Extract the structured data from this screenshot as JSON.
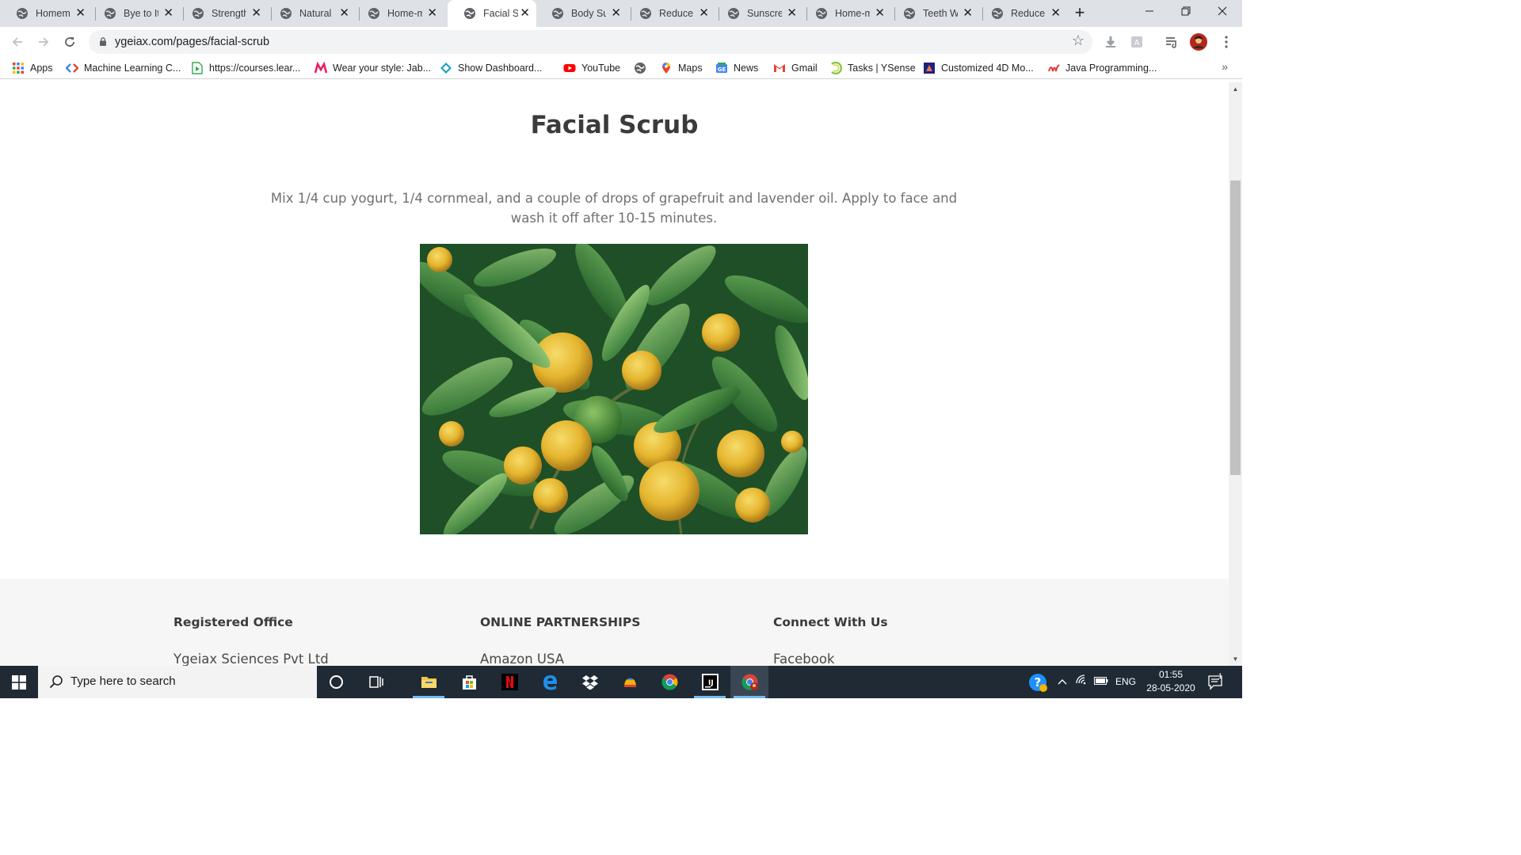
{
  "browser": {
    "tabs": [
      {
        "title": "Homemade"
      },
      {
        "title": "Bye to It"
      },
      {
        "title": "Strength"
      },
      {
        "title": "Natural"
      },
      {
        "title": "Home-made"
      },
      {
        "title": "Facial Scrub",
        "active": true
      },
      {
        "title": "Body Su"
      },
      {
        "title": "Reduce"
      },
      {
        "title": "Sunscreen"
      },
      {
        "title": "Home-m"
      },
      {
        "title": "Teeth W"
      },
      {
        "title": "Reduce"
      }
    ],
    "new_tab": "+",
    "url": "ygeiax.com/pages/facial-scrub",
    "bookmarks": [
      {
        "label": "Apps",
        "icon": "apps-grid-icon"
      },
      {
        "label": "Machine Learning C...",
        "icon": "code-icon"
      },
      {
        "label": "https://courses.lear...",
        "icon": "course-icon"
      },
      {
        "label": "Wear your style: Jab...",
        "icon": "myntra-icon"
      },
      {
        "label": "Show Dashboard...",
        "icon": "dashboard-icon"
      },
      {
        "label": "YouTube",
        "icon": "youtube-icon"
      },
      {
        "label": "",
        "icon": "globe-icon"
      },
      {
        "label": "Maps",
        "icon": "maps-pin-icon"
      },
      {
        "label": "News",
        "icon": "news-icon"
      },
      {
        "label": "Gmail",
        "icon": "gmail-icon"
      },
      {
        "label": "Tasks | YSense",
        "icon": "ysense-icon"
      },
      {
        "label": "Customized 4D Mo...",
        "icon": "customized-icon"
      },
      {
        "label": "Java Programming...",
        "icon": "java-icon"
      }
    ]
  },
  "page": {
    "title": "Facial Scrub",
    "description": "Mix 1/4 cup yogurt, 1/4 cornmeal, and a couple of drops of grapefruit and lavender oil. Apply to face and wash it off after 10-15 minutes.",
    "footer": {
      "columns": [
        {
          "heading": "Registered Office",
          "link": "Ygeiax Sciences Pvt Ltd"
        },
        {
          "heading": "ONLINE PARTNERSHIPS",
          "link": "Amazon USA"
        },
        {
          "heading": "Connect With Us",
          "link": "Facebook"
        }
      ]
    }
  },
  "taskbar": {
    "search_placeholder": "Type here to search",
    "language": "ENG",
    "time": "01:55",
    "date": "28-05-2020",
    "notification_count": "1"
  },
  "colors": {
    "tabstrip": "#dee1e6",
    "taskbar": "#1f2a35",
    "footer_bg": "#f6f6f6",
    "title_text": "#3b3b3b"
  }
}
